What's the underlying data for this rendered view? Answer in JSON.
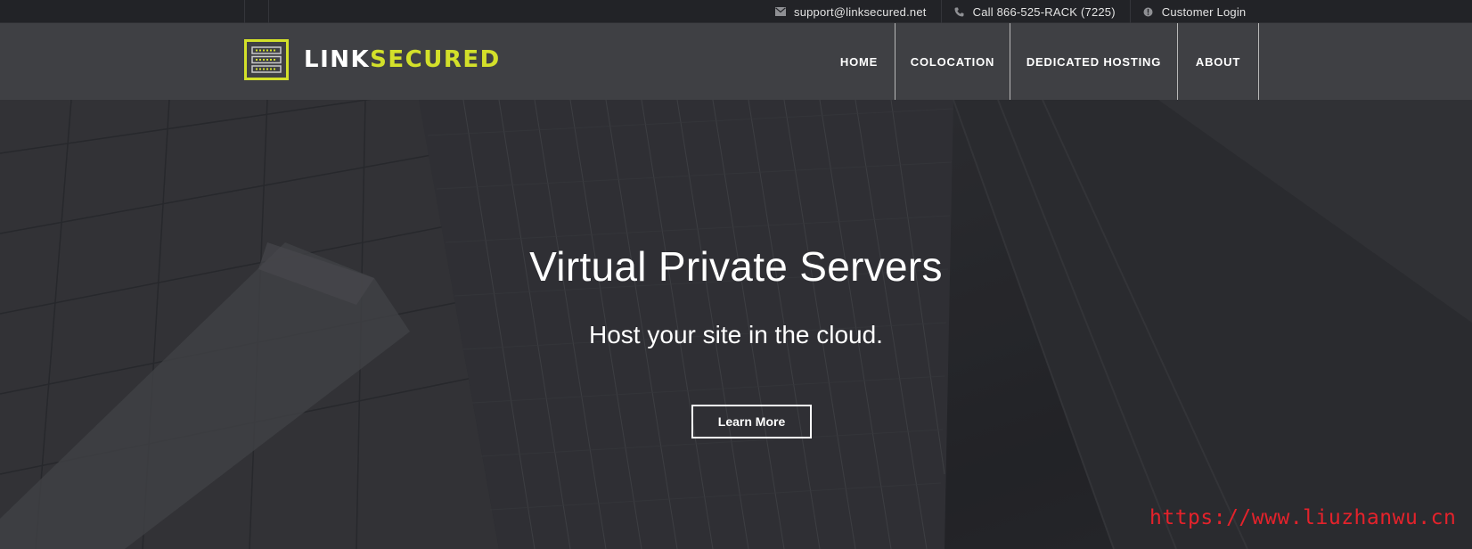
{
  "topbar": {
    "email": {
      "icon": "envelope-icon",
      "label": "support@linksecured.net"
    },
    "phone": {
      "icon": "phone-icon",
      "label": "Call 866-525-RACK (7225)"
    },
    "login": {
      "icon": "info-circle-icon",
      "label": "Customer Login"
    }
  },
  "header": {
    "logo": {
      "icon": "server-rack-icon",
      "text_white": "LINK",
      "text_accent": "SECURED"
    },
    "nav": [
      "HOME",
      "COLOCATION",
      "DEDICATED HOSTING",
      "ABOUT"
    ]
  },
  "hero": {
    "title": "Virtual Private Servers",
    "subtitle": "Host your site in the cloud.",
    "cta": "Learn More",
    "background": "skyscraper-photo"
  },
  "watermark": "https://www.liuzhanwu.cn",
  "colors": {
    "accent": "#d3e02a",
    "topbar_bg": "#222327",
    "header_bg": "#3f4044",
    "hero_overlay": "#2b2c30",
    "watermark": "#e4222b"
  }
}
